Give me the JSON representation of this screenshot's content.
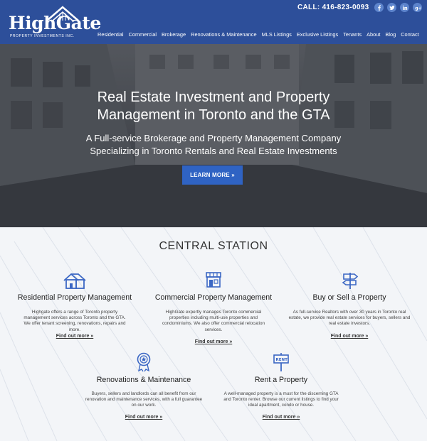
{
  "header": {
    "logo_text": "HighGate",
    "logo_tagline": "PROPERTY INVESTMENTS INC.",
    "phone": "CALL: 416-823-0093",
    "socials": [
      "facebook-icon",
      "twitter-icon",
      "linkedin-icon",
      "google-plus-icon"
    ],
    "nav": [
      "Residential",
      "Commercial",
      "Brokerage",
      "Renovations & Maintenance",
      "MLS Listings",
      "Exclusive Listings",
      "Tenants",
      "About",
      "Blog",
      "Contact"
    ]
  },
  "hero": {
    "title_line1": "Real Estate Investment and Property",
    "title_line2": "Management in Toronto and the GTA",
    "subtitle_line1": "A Full-service Brokerage and Property Management Company",
    "subtitle_line2": "Specializing in Toronto Rentals and Real Estate Investments",
    "cta": "LEARN MORE »"
  },
  "central": {
    "title": "CENTRAL STATION",
    "services": [
      {
        "icon": "house-icon",
        "title": "Residential Property Management",
        "desc": "Highgate offers a range of Toronto property management services across Toronto and the GTA. We offer tenant screening, renovations, repairs and more.",
        "link": "Find out more »"
      },
      {
        "icon": "storefront-icon",
        "title": "Commercial Property Management",
        "desc": "HighGate expertly manages Toronto commercial properties including multi-use properties and condominiums. We also offer commercial relocation services.",
        "link": "Find out more »"
      },
      {
        "icon": "signpost-icon",
        "title": "Buy or Sell a Property",
        "desc": "As full-service Realtors with over 30 years in Toronto real estate, we provide real estate services for buyers, sellers and real estate investors.",
        "link": "Find out more »"
      },
      {
        "icon": "award-ribbon-icon",
        "title": "Renovations & Maintenance",
        "desc": "Buyers, sellers and landlords can all benefit from our renovation and maintenance services, with a full guarantee on our work.",
        "link": "Find out more »"
      },
      {
        "icon": "rent-sign-icon",
        "title": "Rent a Property",
        "desc": "A well-managed property is a must for the discerning GTA and Toronto renter. Browse our current listings to find your ideal apartment, condo or house.",
        "link": "Find out more »"
      }
    ]
  },
  "colors": {
    "header_bg": "#2d4f9a",
    "accent_blue": "#2f63c3",
    "icon_blue": "#3b67c4"
  }
}
